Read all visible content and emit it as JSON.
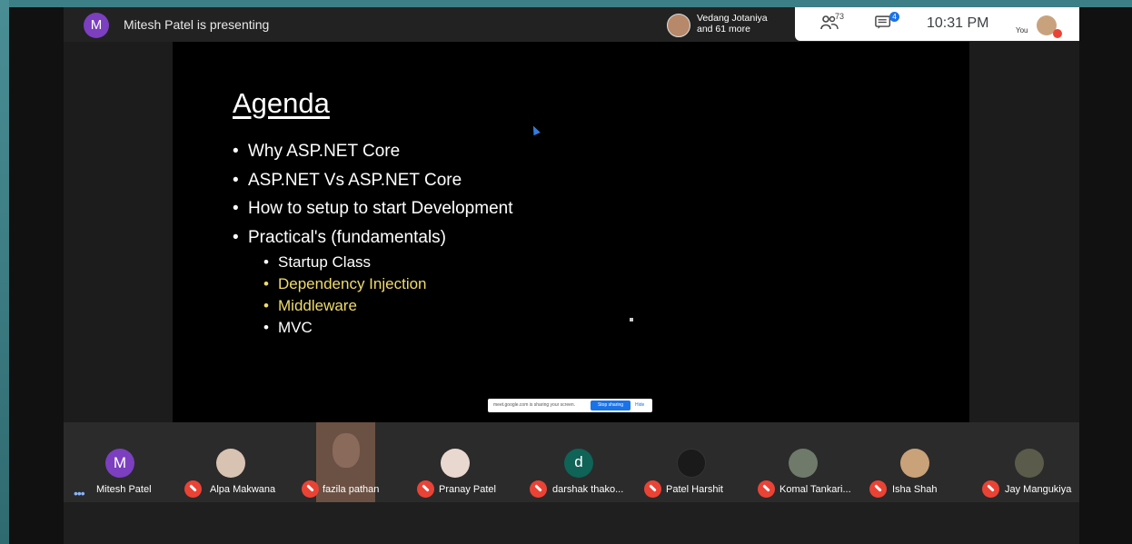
{
  "topbar": {
    "presenter_initial": "M",
    "presenter_text": "Mitesh Patel is presenting",
    "viewer_line1": "Vedang Jotaniya",
    "viewer_line2": "and 61 more",
    "participant_count": "73",
    "chat_badge": "4",
    "time": "10:31 PM",
    "you_label": "You",
    "accent_color": "#1a73e8"
  },
  "slide": {
    "title": "Agenda",
    "bullets": [
      "Why ASP.NET Core",
      "ASP.NET Vs ASP.NET Core",
      "How to setup to start Development",
      "Practical's (fundamentals)"
    ],
    "sub_bullets": [
      "Startup Class",
      "Dependency Injection",
      "Middleware",
      "MVC"
    ],
    "highlight_color": "#f0dc6b"
  },
  "share_bar": {
    "text": "meet.google.com is sharing your screen.",
    "stop_label": "Stop sharing",
    "hide_label": "Hide"
  },
  "participants": [
    {
      "name": "Mitesh Patel",
      "initial": "M"
    },
    {
      "name": "Alpa Makwana"
    },
    {
      "name": "fazila pathan"
    },
    {
      "name": "Pranay Patel"
    },
    {
      "name": "darshak thako...",
      "initial": "d"
    },
    {
      "name": "Patel Harshit"
    },
    {
      "name": "Komal Tankari..."
    },
    {
      "name": "Isha Shah"
    },
    {
      "name": "Jay Mangukiya"
    }
  ]
}
